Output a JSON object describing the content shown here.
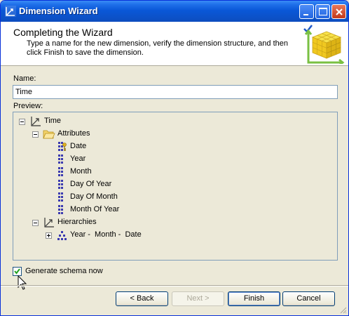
{
  "window": {
    "title": "Dimension Wizard",
    "icon": "dimension-icon"
  },
  "header": {
    "title": "Completing the Wizard",
    "description": "Type a name for the new dimension, verify the dimension structure, and then click Finish to save the dimension.",
    "graphic": "cube-wizard-graphic"
  },
  "form": {
    "name_label": "Name:",
    "name_value": "Time",
    "preview_label": "Preview:"
  },
  "tree": {
    "root": {
      "label": "Time",
      "icon": "dimension-icon",
      "expanded": true
    },
    "attributes": {
      "label": "Attributes",
      "icon": "folder-open-icon",
      "expanded": true,
      "items": [
        {
          "label": "Date",
          "icon": "key-attribute-icon"
        },
        {
          "label": "Year",
          "icon": "attribute-icon"
        },
        {
          "label": "Month",
          "icon": "attribute-icon"
        },
        {
          "label": "Day Of Year",
          "icon": "attribute-icon"
        },
        {
          "label": "Day Of Month",
          "icon": "attribute-icon"
        },
        {
          "label": "Month Of Year",
          "icon": "attribute-icon"
        }
      ]
    },
    "hierarchies": {
      "label": "Hierarchies",
      "icon": "dimension-icon",
      "expanded": true,
      "items": [
        {
          "label": "Year -  Month -  Date",
          "icon": "hierarchy-icon",
          "expanded": false
        }
      ]
    }
  },
  "options": {
    "generate_schema_label": "Generate schema now",
    "generate_schema_checked": true
  },
  "buttons": {
    "back": "< Back",
    "next": "Next >",
    "finish": "Finish",
    "cancel": "Cancel"
  },
  "colors": {
    "titlebar": "#0a58d8",
    "preview_bg": "#ece9d8",
    "accent_check": "#21a121",
    "attribute_icon": "#3b3bb0"
  }
}
